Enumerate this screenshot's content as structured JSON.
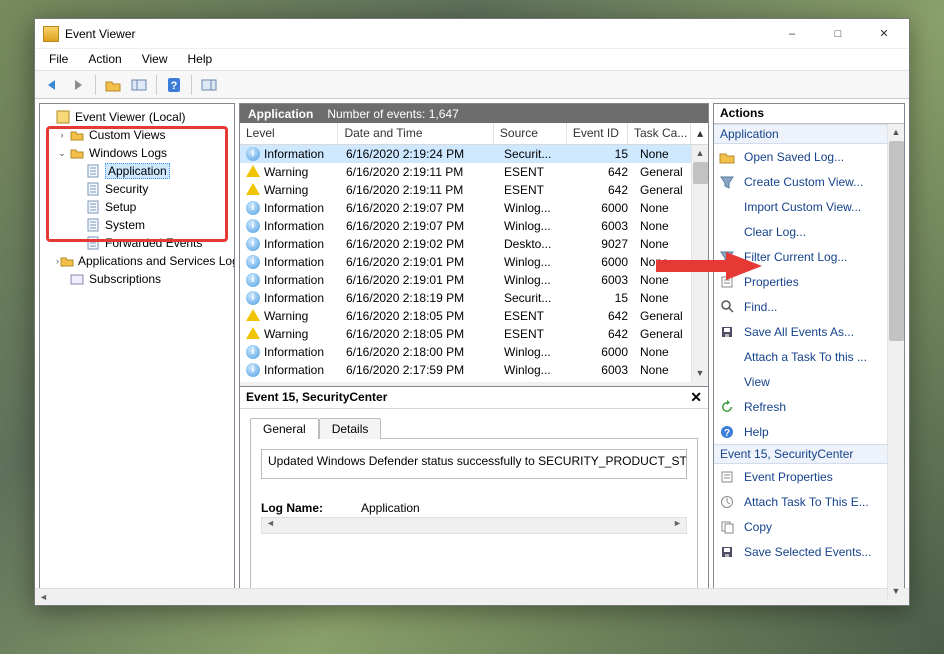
{
  "window": {
    "title": "Event Viewer"
  },
  "menubar": [
    "File",
    "Action",
    "View",
    "Help"
  ],
  "tree": {
    "root": "Event Viewer (Local)",
    "nodes": [
      {
        "label": "Custom Views",
        "indent": 1,
        "twisty": ">",
        "icon": "folder"
      },
      {
        "label": "Windows Logs",
        "indent": 1,
        "twisty": "v",
        "icon": "folder"
      },
      {
        "label": "Application",
        "indent": 2,
        "icon": "log",
        "selected": true
      },
      {
        "label": "Security",
        "indent": 2,
        "icon": "log"
      },
      {
        "label": "Setup",
        "indent": 2,
        "icon": "log"
      },
      {
        "label": "System",
        "indent": 2,
        "icon": "log"
      },
      {
        "label": "Forwarded Events",
        "indent": 2,
        "icon": "log"
      },
      {
        "label": "Applications and Services Log",
        "indent": 1,
        "twisty": ">",
        "icon": "folder"
      },
      {
        "label": "Subscriptions",
        "indent": 1,
        "icon": "sub"
      }
    ]
  },
  "center": {
    "header_title": "Application",
    "header_count": "Number of events: 1,647",
    "columns": {
      "level": "Level",
      "dt": "Date and Time",
      "src": "Source",
      "eid": "Event ID",
      "cat": "Task Ca..."
    },
    "events": [
      {
        "level": "Information",
        "icon": "info",
        "dt": "6/16/2020 2:19:24 PM",
        "src": "Securit...",
        "eid": "15",
        "cat": "None",
        "selected": true
      },
      {
        "level": "Warning",
        "icon": "warn",
        "dt": "6/16/2020 2:19:11 PM",
        "src": "ESENT",
        "eid": "642",
        "cat": "General"
      },
      {
        "level": "Warning",
        "icon": "warn",
        "dt": "6/16/2020 2:19:11 PM",
        "src": "ESENT",
        "eid": "642",
        "cat": "General"
      },
      {
        "level": "Information",
        "icon": "info",
        "dt": "6/16/2020 2:19:07 PM",
        "src": "Winlog...",
        "eid": "6000",
        "cat": "None"
      },
      {
        "level": "Information",
        "icon": "info",
        "dt": "6/16/2020 2:19:07 PM",
        "src": "Winlog...",
        "eid": "6003",
        "cat": "None"
      },
      {
        "level": "Information",
        "icon": "info",
        "dt": "6/16/2020 2:19:02 PM",
        "src": "Deskto...",
        "eid": "9027",
        "cat": "None"
      },
      {
        "level": "Information",
        "icon": "info",
        "dt": "6/16/2020 2:19:01 PM",
        "src": "Winlog...",
        "eid": "6000",
        "cat": "None"
      },
      {
        "level": "Information",
        "icon": "info",
        "dt": "6/16/2020 2:19:01 PM",
        "src": "Winlog...",
        "eid": "6003",
        "cat": "None"
      },
      {
        "level": "Information",
        "icon": "info",
        "dt": "6/16/2020 2:18:19 PM",
        "src": "Securit...",
        "eid": "15",
        "cat": "None"
      },
      {
        "level": "Warning",
        "icon": "warn",
        "dt": "6/16/2020 2:18:05 PM",
        "src": "ESENT",
        "eid": "642",
        "cat": "General"
      },
      {
        "level": "Warning",
        "icon": "warn",
        "dt": "6/16/2020 2:18:05 PM",
        "src": "ESENT",
        "eid": "642",
        "cat": "General"
      },
      {
        "level": "Information",
        "icon": "info",
        "dt": "6/16/2020 2:18:00 PM",
        "src": "Winlog...",
        "eid": "6000",
        "cat": "None"
      },
      {
        "level": "Information",
        "icon": "info",
        "dt": "6/16/2020 2:17:59 PM",
        "src": "Winlog...",
        "eid": "6003",
        "cat": "None"
      }
    ]
  },
  "detail": {
    "header": "Event 15, SecurityCenter",
    "tabs": {
      "general": "General",
      "details": "Details"
    },
    "message": "Updated Windows Defender status successfully to SECURITY_PRODUCT_STA",
    "field_logname_label": "Log Name:",
    "field_logname_value": "Application"
  },
  "actions": {
    "title": "Actions",
    "section1": "Application",
    "items1": [
      {
        "label": "Open Saved Log...",
        "icon": "folder"
      },
      {
        "label": "Create Custom View...",
        "icon": "funnel"
      },
      {
        "label": "Import Custom View...",
        "icon": "blank"
      },
      {
        "label": "Clear Log...",
        "icon": "blank"
      },
      {
        "label": "Filter Current Log...",
        "icon": "funnel"
      },
      {
        "label": "Properties",
        "icon": "props"
      },
      {
        "label": "Find...",
        "icon": "find"
      },
      {
        "label": "Save All Events As...",
        "icon": "save"
      },
      {
        "label": "Attach a Task To this ...",
        "icon": "blank"
      },
      {
        "label": "View",
        "icon": "blank",
        "arrow": true
      },
      {
        "label": "Refresh",
        "icon": "refresh"
      },
      {
        "label": "Help",
        "icon": "help",
        "arrow": true
      }
    ],
    "section2": "Event 15, SecurityCenter",
    "items2": [
      {
        "label": "Event Properties",
        "icon": "props"
      },
      {
        "label": "Attach Task To This E...",
        "icon": "task"
      },
      {
        "label": "Copy",
        "icon": "copy",
        "arrow": true
      },
      {
        "label": "Save Selected Events...",
        "icon": "save"
      }
    ]
  }
}
